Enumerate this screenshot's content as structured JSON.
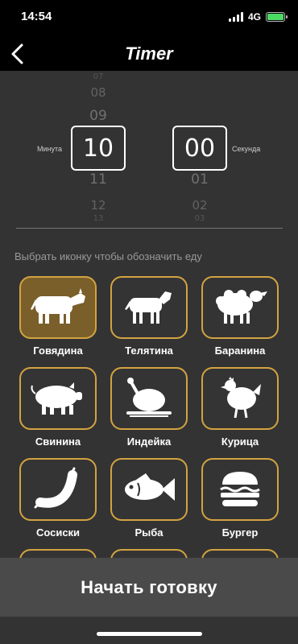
{
  "status_bar": {
    "time": "14:54",
    "network": "4G",
    "battery_color": "#4cd964"
  },
  "nav": {
    "title": "Timer",
    "back_icon": "chevron-left-icon"
  },
  "timer": {
    "minutes_label": "Минута",
    "seconds_label": "Секунда",
    "minutes_value": "10",
    "seconds_value": "00",
    "minutes_above": [
      "07",
      "08",
      "09"
    ],
    "minutes_below": [
      "11",
      "12",
      "13"
    ],
    "seconds_above": [
      "",
      "",
      ""
    ],
    "seconds_below": [
      "01",
      "02",
      "03"
    ]
  },
  "hint": "Выбрать иконку чтобы обозначить еду",
  "accent_color": "#d3a341",
  "food_items": [
    {
      "label": "Говядина",
      "icon": "cow-icon",
      "selected": true
    },
    {
      "label": "Телятина",
      "icon": "calf-icon",
      "selected": false
    },
    {
      "label": "Баранина",
      "icon": "sheep-icon",
      "selected": false
    },
    {
      "label": "Свинина",
      "icon": "pig-icon",
      "selected": false
    },
    {
      "label": "Индейка",
      "icon": "roast-turkey-icon",
      "selected": false
    },
    {
      "label": "Курица",
      "icon": "chicken-icon",
      "selected": false
    },
    {
      "label": "Сосиски",
      "icon": "sausage-icon",
      "selected": false
    },
    {
      "label": "Рыба",
      "icon": "fish-icon",
      "selected": false
    },
    {
      "label": "Бургер",
      "icon": "burger-icon",
      "selected": false
    }
  ],
  "start_button": {
    "label": "Начать готовку"
  }
}
